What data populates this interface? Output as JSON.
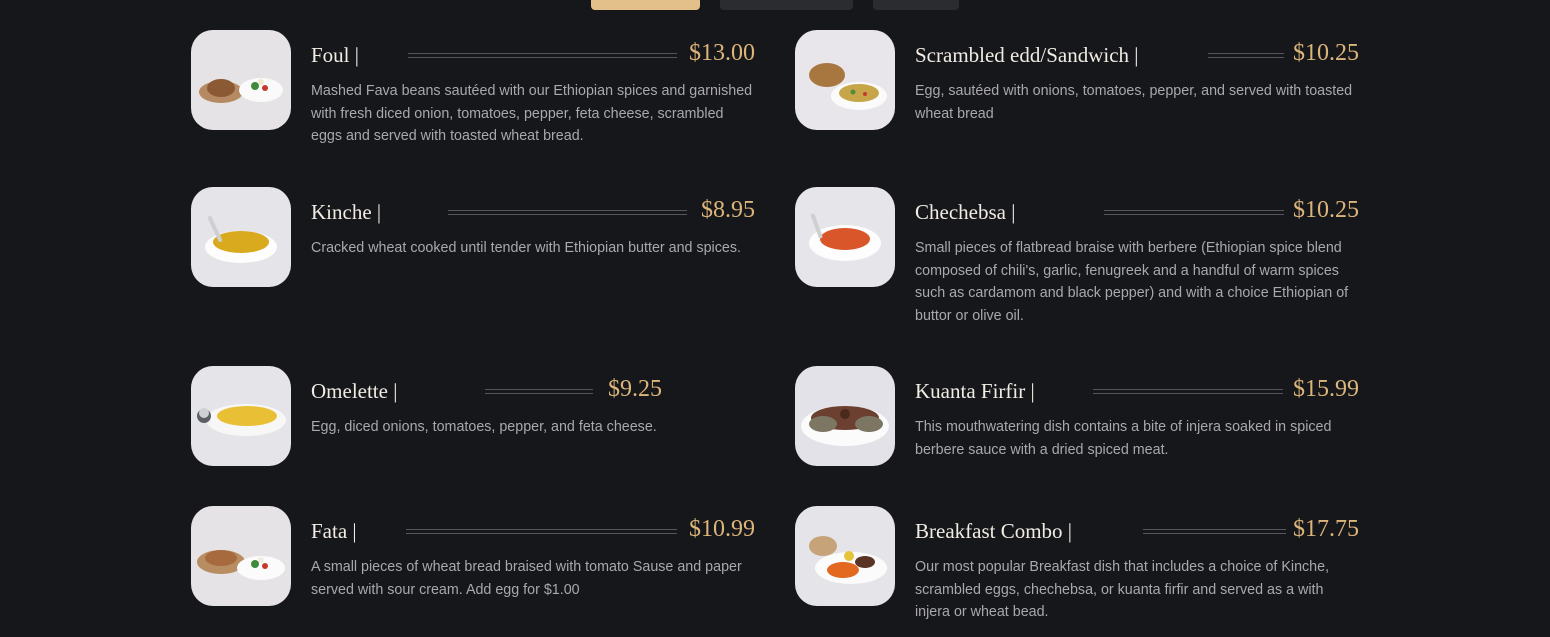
{
  "tabs": [
    {
      "label": "",
      "active": true
    },
    {
      "label": "",
      "active": false
    },
    {
      "label": "",
      "active": false
    }
  ],
  "menu": {
    "items": [
      {
        "name": "Foul |",
        "price": "$13.00",
        "description": "Mashed Fava beans sautéed with our Ethiopian spices and garnished with fresh diced onion, tomatoes, pepper, feta cheese, scrambled eggs and served with toasted wheat bread."
      },
      {
        "name": "Scrambled edd/Sandwich |",
        "price": "$10.25",
        "description": "Egg, sautéed with onions, tomatoes, pepper, and served with toasted wheat bread"
      },
      {
        "name": "Kinche |",
        "price": "$8.95",
        "description": "Cracked wheat cooked until tender with Ethiopian butter and spices."
      },
      {
        "name": "Chechebsa |",
        "price": "$10.25",
        "description": "Small pieces of flatbread braise with berbere (Ethiopian spice blend composed of chili's, garlic, fenugreek and a handful of warm spices such as cardamom and black pepper) and with a choice Ethiopian of buttor or olive oil."
      },
      {
        "name": "Omelette |",
        "price": "$9.25",
        "description": "Egg, diced onions, tomatoes, pepper, and feta cheese."
      },
      {
        "name": "Kuanta Firfir |",
        "price": "$15.99",
        "description": "This mouthwatering dish contains a bite of injera soaked in spiced berbere sauce with a dried spiced meat."
      },
      {
        "name": "Fata |",
        "price": "$10.99",
        "description": "A small pieces of wheat bread braised with tomato Sause and paper served with sour cream. Add egg for $1.00"
      },
      {
        "name": "Breakfast Combo |",
        "price": "$17.75",
        "description": "Our most popular Breakfast dish that includes a choice of Kinche, scrambled eggs, chechebsa, or kuanta firfir and served as a with injera or wheat bead."
      }
    ]
  },
  "colors": {
    "background": "#16171a",
    "accent": "#dcb57a",
    "active_tab": "#e3c08a"
  }
}
